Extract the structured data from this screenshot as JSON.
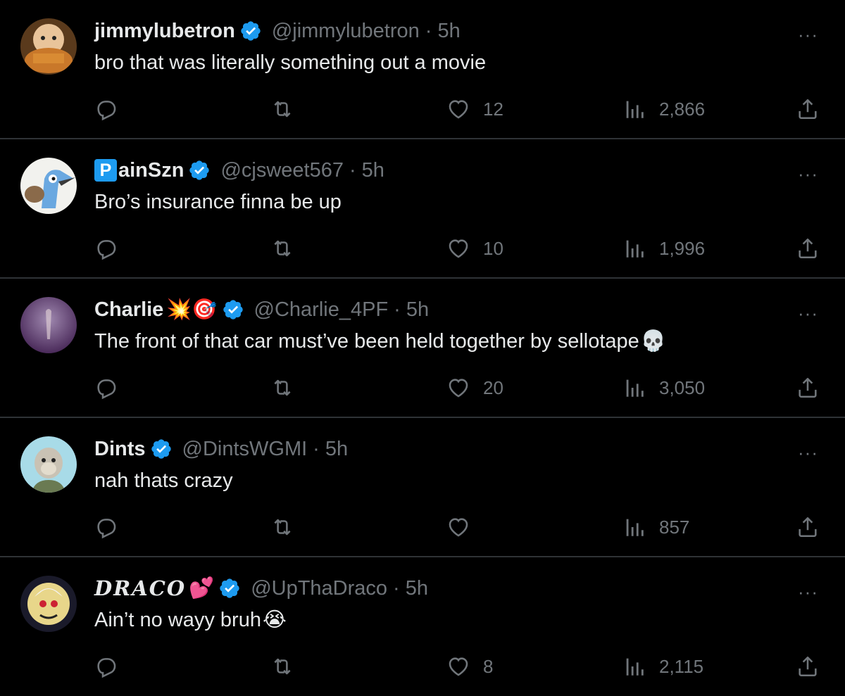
{
  "colors": {
    "background": "#000000",
    "text": "#e7e9ea",
    "muted": "#71767b",
    "verified": "#1d9bf0",
    "divider": "#2f3336"
  },
  "tweets": [
    {
      "name": "jimmylubetron",
      "handle": "@jimmylubetron",
      "dot": "·",
      "time": "5h",
      "text": "bro that was literally something out a movie",
      "likes": "12",
      "views": "2,866",
      "more": "···"
    },
    {
      "name_badge": "P",
      "name": "ainSzn",
      "handle": "@cjsweet567",
      "dot": "·",
      "time": "5h",
      "text": "Bro’s insurance finna be up",
      "likes": "10",
      "views": "1,996",
      "more": "···"
    },
    {
      "name": "Charlie",
      "name_emoji": "💥🎯",
      "handle": "@Charlie_4PF",
      "dot": "·",
      "time": "5h",
      "text": "The front of that car must’ve been held together by sellotape",
      "text_emoji": "💀",
      "likes": "20",
      "views": "3,050",
      "more": "···"
    },
    {
      "name": "Dints",
      "handle": "@DintsWGMI",
      "dot": "·",
      "time": "5h",
      "text": "nah thats crazy",
      "likes": "",
      "views": "857",
      "more": "···"
    },
    {
      "name": "𝑫𝑹𝑨𝑪𝑶",
      "name_emoji": "💕",
      "handle": "@UpThaDraco",
      "dot": "·",
      "time": "5h",
      "text": "Ain’t no wayy bruh",
      "text_emoji": "😭",
      "likes": "8",
      "views": "2,115",
      "more": "···"
    }
  ],
  "icons": {
    "reply": "reply-icon",
    "retweet": "retweet-icon",
    "like": "heart-icon",
    "views": "views-icon",
    "share": "share-icon",
    "more": "more-icon",
    "verified": "verified-badge-icon"
  }
}
